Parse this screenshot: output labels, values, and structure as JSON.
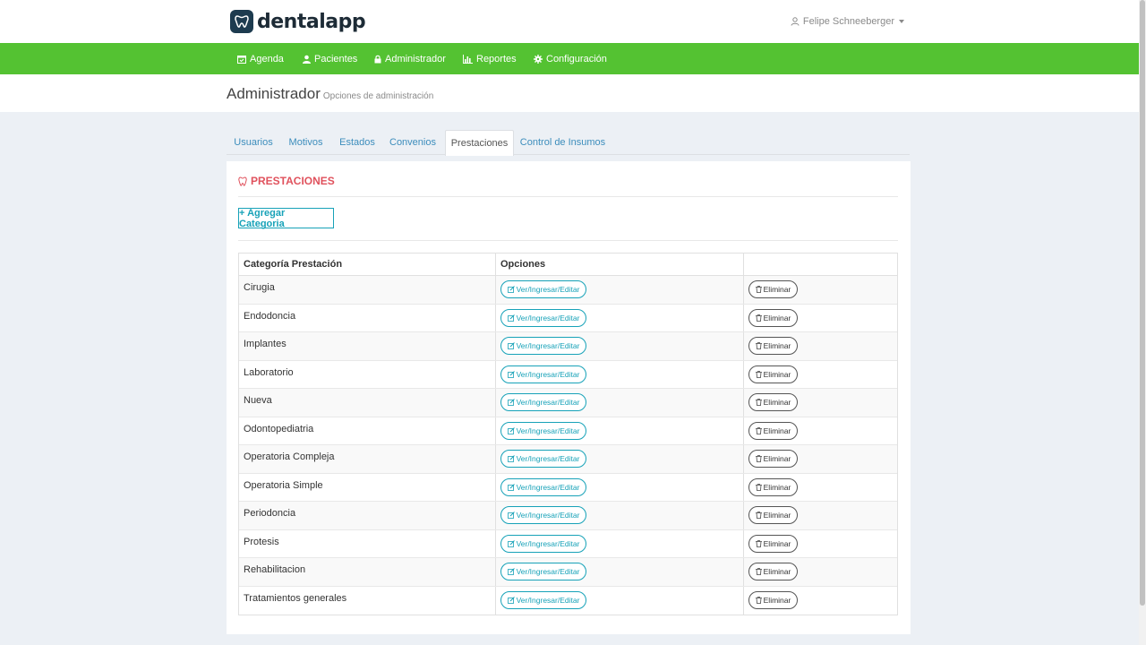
{
  "brand": {
    "name": "dentalapp",
    "color": "#1d3b4f"
  },
  "user": {
    "name": "Felipe Schneeberger"
  },
  "nav": [
    {
      "label": "Agenda",
      "icon": "calendar-icon"
    },
    {
      "label": "Pacientes",
      "icon": "user-icon"
    },
    {
      "label": "Administrador",
      "icon": "lock-icon"
    },
    {
      "label": "Reportes",
      "icon": "bar-chart-icon"
    },
    {
      "label": "Configuración",
      "icon": "gear-icon"
    }
  ],
  "header": {
    "title": "Administrador",
    "subtitle": "Opciones de administración"
  },
  "tabs": [
    {
      "label": "Usuarios",
      "active": false
    },
    {
      "label": "Motivos",
      "active": false
    },
    {
      "label": "Estados",
      "active": false
    },
    {
      "label": "Convenios",
      "active": false
    },
    {
      "label": "Prestaciones",
      "active": true
    },
    {
      "label": "Control de Insumos",
      "active": false
    }
  ],
  "panel": {
    "title": "PRESTACIONES",
    "add_button": "+ Agregar Categoria",
    "columns": [
      "Categoría Prestación",
      "Opciones",
      ""
    ],
    "edit_label": "Ver/Ingresar/Editar",
    "delete_label": "Eliminar",
    "rows": [
      "Cirugia",
      "Endodoncia",
      "Implantes",
      "Laboratorio",
      "Nueva",
      "Odontopediatria",
      "Operatoria Compleja",
      "Operatoria Simple",
      "Periodoncia",
      "Protesis",
      "Rehabilitacion",
      "Tratamientos generales"
    ]
  },
  "colors": {
    "nav": "#54c232",
    "accent": "#17a2b8",
    "title": "#e0525d"
  }
}
